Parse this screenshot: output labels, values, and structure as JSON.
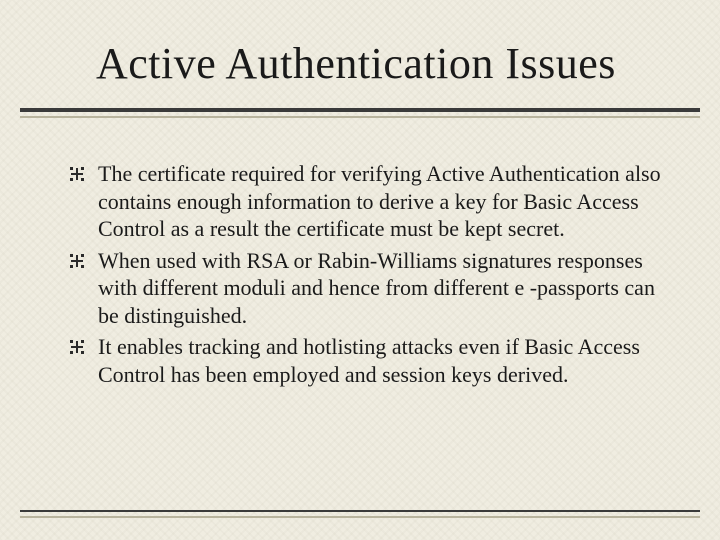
{
  "title": "Active Authentication Issues",
  "bullets": [
    "The certificate required for verifying Active Authentication also contains enough information to derive a key for Basic Access Control as a result the certificate must be kept secret.",
    "When used with RSA or Rabin-Williams signatures responses with different moduli and hence from different e -passports can be distinguished.",
    "It enables tracking and hotlisting attacks even if Basic Access Control has been employed and session keys derived."
  ]
}
